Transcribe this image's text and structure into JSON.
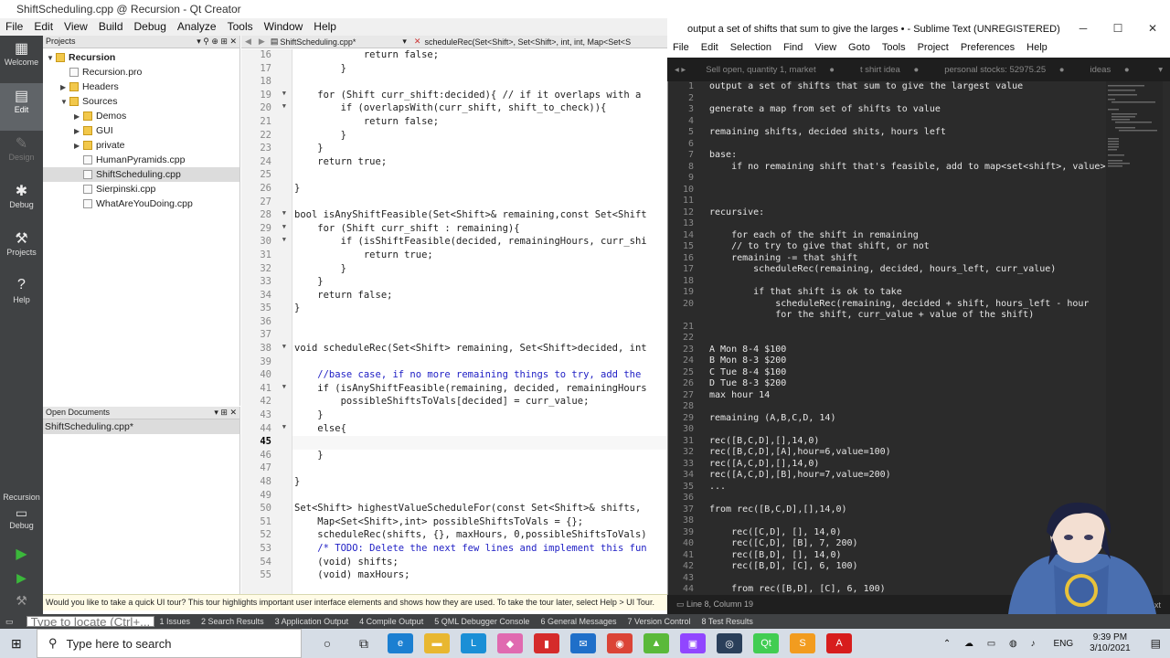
{
  "qt": {
    "title": "ShiftScheduling.cpp @ Recursion - Qt Creator",
    "menu": [
      "File",
      "Edit",
      "View",
      "Build",
      "Debug",
      "Analyze",
      "Tools",
      "Window",
      "Help"
    ],
    "modes": [
      {
        "label": "Welcome",
        "icon": "grid-icon"
      },
      {
        "label": "Edit",
        "icon": "document-icon"
      },
      {
        "label": "Design",
        "icon": "pen-icon"
      },
      {
        "label": "Debug",
        "icon": "bug-icon"
      },
      {
        "label": "Projects",
        "icon": "wrench-icon"
      },
      {
        "label": "Help",
        "icon": "help-icon"
      }
    ],
    "kit_label": "Recursion",
    "kit_mode": "Debug",
    "projects_header": "Projects",
    "tree": [
      {
        "label": "Recursion",
        "level": 0,
        "type": "project",
        "expanded": true
      },
      {
        "label": "Recursion.pro",
        "level": 1,
        "type": "file"
      },
      {
        "label": "Headers",
        "level": 1,
        "type": "folder",
        "expanded": false
      },
      {
        "label": "Sources",
        "level": 1,
        "type": "folder",
        "expanded": true
      },
      {
        "label": "Demos",
        "level": 2,
        "type": "folder",
        "expanded": false
      },
      {
        "label": "GUI",
        "level": 2,
        "type": "folder",
        "expanded": false
      },
      {
        "label": "private",
        "level": 2,
        "type": "folder",
        "expanded": false
      },
      {
        "label": "HumanPyramids.cpp",
        "level": 2,
        "type": "file"
      },
      {
        "label": "ShiftScheduling.cpp",
        "level": 2,
        "type": "file",
        "selected": true
      },
      {
        "label": "Sierpinski.cpp",
        "level": 2,
        "type": "file"
      },
      {
        "label": "WhatAreYouDoing.cpp",
        "level": 2,
        "type": "file"
      }
    ],
    "open_docs_header": "Open Documents",
    "open_docs": [
      "ShiftScheduling.cpp*"
    ],
    "editor_file": "ShiftScheduling.cpp*",
    "editor_symbol": "scheduleRec(Set<Shift>, Set<Shift>, int, int, Map<Set<S",
    "line_numbers": [
      "16",
      "17",
      "18",
      "19",
      "20",
      "21",
      "22",
      "23",
      "24",
      "25",
      "26",
      "27",
      "28",
      "29",
      "30",
      "31",
      "32",
      "33",
      "34",
      "35",
      "36",
      "37",
      "38",
      "39",
      "40",
      "41",
      "42",
      "43",
      "44",
      "45",
      "46",
      "47",
      "48",
      "49",
      "50",
      "51",
      "52",
      "53",
      "54",
      "55"
    ],
    "code_lines": [
      "            return false;",
      "        }",
      "",
      "    for (Shift curr_shift:decided){ // if it overlaps with a",
      "        if (overlapsWith(curr_shift, shift_to_check)){",
      "            return false;",
      "        }",
      "    }",
      "    return true;",
      "",
      "}",
      "",
      "bool isAnyShiftFeasible(Set<Shift>& remaining,const Set<Shift",
      "    for (Shift curr_shift : remaining){",
      "        if (isShiftFeasible(decided, remainingHours, curr_shi",
      "            return true;",
      "        }",
      "    }",
      "    return false;",
      "}",
      "",
      "",
      "void scheduleRec(Set<Shift> remaining, Set<Shift>decided, int",
      "",
      "    //base case, if no more remaining things to try, add the",
      "    if (isAnyShiftFeasible(remaining, decided, remainingHours",
      "        possibleShiftsToVals[decided] = curr_value;",
      "    }",
      "    else{",
      "",
      "    }",
      "",
      "}",
      "",
      "Set<Shift> highestValueScheduleFor(const Set<Shift>& shifts,",
      "    Map<Set<Shift>,int> possibleShiftsToVals = {};",
      "    scheduleRec(shifts, {}, maxHours, 0,possibleShiftsToVals)",
      "    /* TODO: Delete the next few lines and implement this fun",
      "    (void) shifts;",
      "    (void) maxHours;"
    ],
    "tour_text": "Would you like to take a quick UI tour? This tour highlights important user interface elements and shows how they are used. To take the tour later, select Help > UI Tour.",
    "locate_placeholder": "Type to locate (Ctrl+...",
    "output_tabs": [
      "1 Issues",
      "2 Search Results",
      "3 Application Output",
      "4 Compile Output",
      "5 QML Debugger Console",
      "6 General Messages",
      "7 Version Control",
      "8 Test Results"
    ]
  },
  "sublime": {
    "title": "output a set of shifts that sum to give the larges • - Sublime Text (UNREGISTERED)",
    "menu": [
      "File",
      "Edit",
      "Selection",
      "Find",
      "View",
      "Goto",
      "Tools",
      "Project",
      "Preferences",
      "Help"
    ],
    "tabs": [
      "Sell open, quantity 1, market",
      "t shirt idea",
      "personal stocks: 52975.25",
      "ideas"
    ],
    "line_numbers": [
      "1",
      "2",
      "3",
      "4",
      "5",
      "6",
      "7",
      "8",
      "9",
      "10",
      "11",
      "12",
      "13",
      "14",
      "15",
      "16",
      "17",
      "18",
      "19",
      "20",
      "",
      "21",
      "22",
      "23",
      "24",
      "25",
      "26",
      "27",
      "28",
      "29",
      "30",
      "31",
      "32",
      "33",
      "34",
      "35",
      "36",
      "37",
      "38",
      "39",
      "40",
      "41",
      "42",
      "43",
      "44"
    ],
    "lines": [
      "output a set of shifts that sum to give the largest value",
      "",
      "generate a map from set of shifts to value",
      "",
      "remaining shifts, decided shits, hours left",
      "",
      "base:",
      "    if no remaining shift that's feasible, add to map<set<shift>, value>",
      "",
      "",
      "",
      "recursive:",
      "",
      "    for each of the shift in remaining",
      "    // to try to give that shift, or not",
      "    remaining -= that shift",
      "        scheduleRec(remaining, decided, hours_left, curr_value)",
      "",
      "        if that shift is ok to take",
      "            scheduleRec(remaining, decided + shift, hours_left - hour",
      "            for the shift, curr_value + value of the shift)",
      "",
      "",
      "A Mon 8-4 $100",
      "B Mon 8-3 $200",
      "C Tue 8-4 $100",
      "D Tue 8-3 $200",
      "max hour 14",
      "",
      "remaining (A,B,C,D, 14)",
      "",
      "rec([B,C,D],[],14,0)",
      "rec([B,C,D],[A],hour=6,value=100)",
      "rec([A,C,D],[],14,0)",
      "rec([A,C,D],[B],hour=7,value=200)",
      "...",
      "",
      "from rec([B,C,D],[],14,0)",
      "",
      "    rec([C,D], [], 14,0)",
      "    rec([C,D], [B], 7, 200)",
      "    rec([B,D], [], 14,0)",
      "    rec([B,D], [C], 6, 100)",
      "",
      "    from rec([B,D], [C], 6, 100)"
    ],
    "status_left": "Line 8, Column 19",
    "status_right": "Plain Text"
  },
  "taskbar": {
    "search_placeholder": "Type here to search",
    "language": "ENG",
    "time": "9:39 PM",
    "date": "3/10/2021",
    "icons": [
      "cortana-icon",
      "task-view-icon",
      "edge-icon",
      "file-explorer-icon",
      "app-l-icon",
      "app-pink-icon",
      "app-red-icon",
      "mail-icon",
      "chrome-icon",
      "app-green-icon",
      "twitch-icon",
      "steam-icon",
      "qt-icon",
      "sublime-icon",
      "acrobat-icon"
    ]
  }
}
